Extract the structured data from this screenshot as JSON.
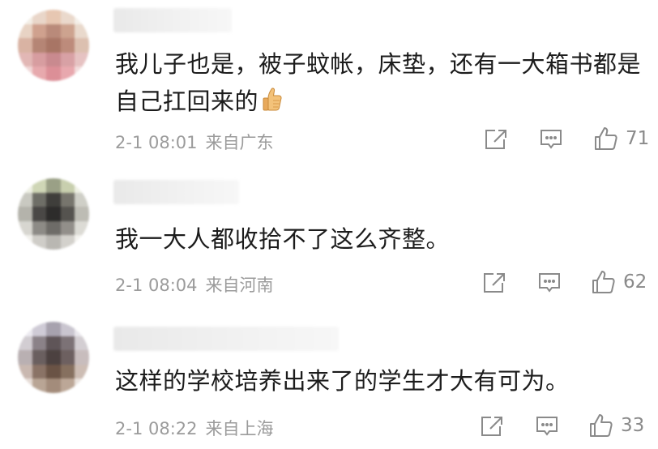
{
  "comments": [
    {
      "text": "我儿子也是，被子蚊帐，床垫，还有一大箱书都是自己扛回来的",
      "emoji": "thumbs-up-icon",
      "time": "2-1 08:01",
      "location": "来自广东",
      "likes": "71",
      "avatar_colors": [
        "#f3eee6",
        "#e9d6c9",
        "#e7c7b2",
        "#ead9cc",
        "#f4efe8",
        "#e8d3c4",
        "#cfa18e",
        "#b98a7a",
        "#cda38f",
        "#e9d9cc",
        "#d9b3a3",
        "#b58575",
        "#a87565",
        "#bd8b7b",
        "#dcc0b0",
        "#e2b7b5",
        "#d79da0",
        "#c98a8f",
        "#d8a1a5",
        "#e6c2c2",
        "#f0d6d6",
        "#e7a9ad",
        "#dc8f97",
        "#e8a8ae",
        "#f2dcdc"
      ]
    },
    {
      "text": "我一大人都收拾不了这么齐整。",
      "time": "2-1 08:04",
      "location": "来自河南",
      "likes": "62",
      "avatar_colors": [
        "#eef0e4",
        "#cfd6b6",
        "#9aa086",
        "#c8cfae",
        "#eef0e4",
        "#c9c9c1",
        "#6e6e67",
        "#3f3e3b",
        "#77756d",
        "#cfcfc7",
        "#b4b3ab",
        "#4a4846",
        "#2d2c2b",
        "#55534f",
        "#bdbcb4",
        "#d7d6d0",
        "#8d8b86",
        "#6e6c68",
        "#928f8a",
        "#dcdbd5",
        "#f1f0ec",
        "#cfcdc8",
        "#b9b7b2",
        "#d3d1cc",
        "#f3f2ee"
      ]
    },
    {
      "text": "这样的学校培养出来了的学生才大有可为。",
      "time": "2-1 08:22",
      "location": "来自上海",
      "likes": "33",
      "avatar_colors": [
        "#eceaf0",
        "#cfcbd6",
        "#a7a2ae",
        "#c9c5cf",
        "#e9e7ec",
        "#d2cdd2",
        "#8b8288",
        "#5f5558",
        "#7c7276",
        "#d3ced2",
        "#b9b0b2",
        "#6a5f5f",
        "#4c4140",
        "#6d6060",
        "#c8bdbd",
        "#c9b8b0",
        "#8a7366",
        "#6a5345",
        "#86705f",
        "#cdbdb4",
        "#e6dcd6",
        "#b9a595",
        "#a38c7b",
        "#bca797",
        "#ebe4df"
      ]
    }
  ]
}
